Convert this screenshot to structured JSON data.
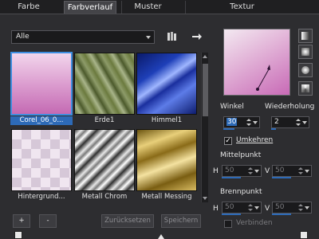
{
  "tabs": [
    "Farbe",
    "Farbverlauf",
    "Muster",
    "Textur"
  ],
  "category": {
    "selected": "Alle"
  },
  "gradients": [
    {
      "label": "Corel_06_0...",
      "selected": true
    },
    {
      "label": "Erde1",
      "selected": false
    },
    {
      "label": "Himmel1",
      "selected": false
    },
    {
      "label": "Hintergrund...",
      "selected": false
    },
    {
      "label": "Metall Chrom",
      "selected": false
    },
    {
      "label": "Metall Messing",
      "selected": false
    }
  ],
  "buttons": {
    "add": "+",
    "remove": "-",
    "reset": "Zurücksetzen",
    "save": "Speichern"
  },
  "properties": {
    "angle_label": "Winkel",
    "angle_value": "30",
    "repeat_label": "Wiederholung",
    "repeat_value": "2",
    "invert_label": "Umkehren",
    "invert_checked": true,
    "center_label": "Mittelpunkt",
    "center_h": "50",
    "center_v": "50",
    "focus_label": "Brennpunkt",
    "focus_h": "50",
    "focus_v": "50",
    "h_label": "H",
    "v_label": "V",
    "link_label": "Verbinden"
  },
  "colors": {
    "accent": "#2d6ab7",
    "background": "#2d2d30"
  }
}
